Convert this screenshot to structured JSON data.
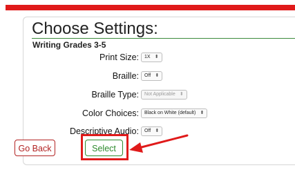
{
  "panel": {
    "title": "Choose Settings:",
    "subtitle": "Writing Grades 3-5"
  },
  "settings": [
    {
      "label": "Print Size:",
      "value": "1X"
    },
    {
      "label": "Braille:",
      "value": "Off"
    },
    {
      "label": "Braille Type:",
      "value": "Not Applicable",
      "disabled": true
    },
    {
      "label": "Color Choices:",
      "value": "Black on White (default)"
    },
    {
      "label": "Descriptive Audio:",
      "value": "Off"
    }
  ],
  "buttons": {
    "go_back": "Go Back",
    "select": "Select"
  },
  "select_arrow_glyph": "⬍",
  "colors": {
    "top_bar": "#e01a1a",
    "highlight": "#e01a1a",
    "go_back": "#b22222",
    "select": "#2d8a2d"
  }
}
